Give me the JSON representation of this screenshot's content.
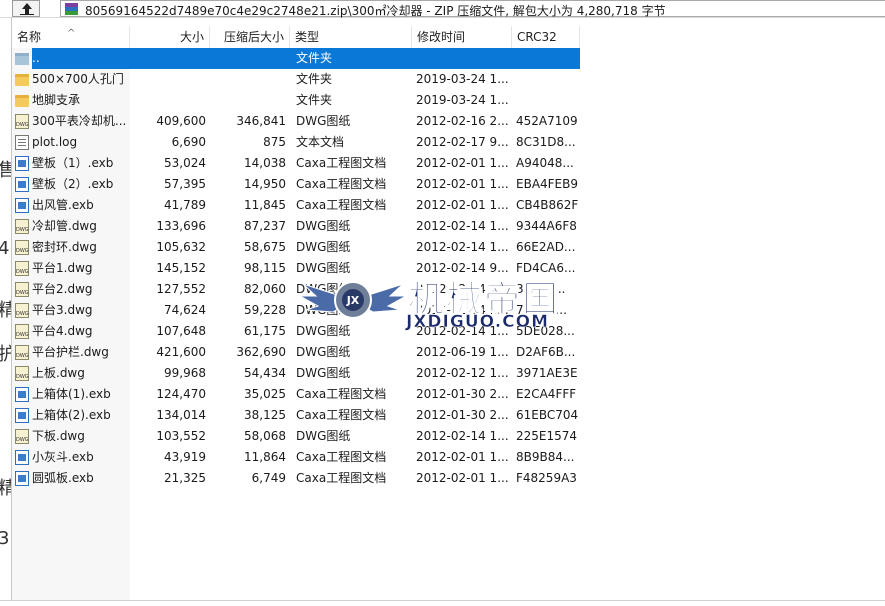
{
  "pathbar": {
    "path_text": "80569164522d7489e70c4e29c2748e21.zip\\300㎡冷却器 - ZIP 压缩文件, 解包大小为 4,280,718 字节"
  },
  "columns": {
    "name": "名称",
    "size": "大小",
    "packed": "压缩后大小",
    "type": "类型",
    "modified": "修改时间",
    "crc": "CRC32"
  },
  "rows": [
    {
      "name": "..",
      "icon": "folder-up",
      "size": "",
      "packed": "",
      "type": "文件夹",
      "modified": "",
      "crc": ""
    },
    {
      "name": "500×700人孔门",
      "icon": "folder",
      "size": "",
      "packed": "",
      "type": "文件夹",
      "modified": "2019-03-24 1...",
      "crc": ""
    },
    {
      "name": "地脚支承",
      "icon": "folder",
      "size": "",
      "packed": "",
      "type": "文件夹",
      "modified": "2019-03-24 1...",
      "crc": ""
    },
    {
      "name": "300平表冷却机...",
      "icon": "dwg",
      "size": "409,600",
      "packed": "346,841",
      "type": "DWG图纸",
      "modified": "2012-02-16 2...",
      "crc": "452A7109"
    },
    {
      "name": "plot.log",
      "icon": "txt",
      "size": "6,690",
      "packed": "875",
      "type": "文本文档",
      "modified": "2012-02-17 9...",
      "crc": "8C31D8..."
    },
    {
      "name": "壁板（1）.exb",
      "icon": "exb",
      "size": "53,024",
      "packed": "14,038",
      "type": "Caxa工程图文档",
      "modified": "2012-02-01 1...",
      "crc": "A94048..."
    },
    {
      "name": "壁板（2）.exb",
      "icon": "exb",
      "size": "57,395",
      "packed": "14,950",
      "type": "Caxa工程图文档",
      "modified": "2012-02-01 1...",
      "crc": "EBA4FEB9"
    },
    {
      "name": "出风管.exb",
      "icon": "exb",
      "size": "41,789",
      "packed": "11,845",
      "type": "Caxa工程图文档",
      "modified": "2012-02-01 1...",
      "crc": "CB4B862F"
    },
    {
      "name": "冷却管.dwg",
      "icon": "dwg",
      "size": "133,696",
      "packed": "87,237",
      "type": "DWG图纸",
      "modified": "2012-02-14 1...",
      "crc": "9344A6F8"
    },
    {
      "name": "密封环.dwg",
      "icon": "dwg",
      "size": "105,632",
      "packed": "58,675",
      "type": "DWG图纸",
      "modified": "2012-02-14 1...",
      "crc": "66E2AD..."
    },
    {
      "name": "平台1.dwg",
      "icon": "dwg",
      "size": "145,152",
      "packed": "98,115",
      "type": "DWG图纸",
      "modified": "2012-02-14 9...",
      "crc": "FD4CA6..."
    },
    {
      "name": "平台2.dwg",
      "icon": "dwg",
      "size": "127,552",
      "packed": "82,060",
      "type": "DWG图纸",
      "modified": "2012-02-14 1...",
      "crc": "3F8B2..."
    },
    {
      "name": "平台3.dwg",
      "icon": "dwg",
      "size": "74,624",
      "packed": "59,228",
      "type": "DWG图纸",
      "modified": "2012-02-14 1...",
      "crc": "7A1C0..."
    },
    {
      "name": "平台4.dwg",
      "icon": "dwg",
      "size": "107,648",
      "packed": "61,175",
      "type": "DWG图纸",
      "modified": "2012-02-14 1...",
      "crc": "5DE028..."
    },
    {
      "name": "平台护栏.dwg",
      "icon": "dwg",
      "size": "421,600",
      "packed": "362,690",
      "type": "DWG图纸",
      "modified": "2012-06-19 1...",
      "crc": "D2AF6B..."
    },
    {
      "name": "上板.dwg",
      "icon": "dwg",
      "size": "99,968",
      "packed": "54,434",
      "type": "DWG图纸",
      "modified": "2012-02-12 1...",
      "crc": "3971AE3E"
    },
    {
      "name": "上箱体(1).exb",
      "icon": "exb",
      "size": "124,470",
      "packed": "35,025",
      "type": "Caxa工程图文档",
      "modified": "2012-01-30 2...",
      "crc": "E2CA4FFF"
    },
    {
      "name": "上箱体(2).exb",
      "icon": "exb",
      "size": "134,014",
      "packed": "38,125",
      "type": "Caxa工程图文档",
      "modified": "2012-01-30 2...",
      "crc": "61EBC704"
    },
    {
      "name": "下板.dwg",
      "icon": "dwg",
      "size": "103,552",
      "packed": "58,068",
      "type": "DWG图纸",
      "modified": "2012-02-14 1...",
      "crc": "225E1574"
    },
    {
      "name": "小灰斗.exb",
      "icon": "exb",
      "size": "43,919",
      "packed": "11,864",
      "type": "Caxa工程图文档",
      "modified": "2012-02-01 1...",
      "crc": "8B9B84..."
    },
    {
      "name": "圆弧板.exb",
      "icon": "exb",
      "size": "21,325",
      "packed": "6,749",
      "type": "Caxa工程图文档",
      "modified": "2012-02-01 1...",
      "crc": "F48259A3"
    }
  ],
  "watermark": {
    "title": "机械帝国",
    "url": "JXDIGUO.COM",
    "logo_text": "JX"
  },
  "left_edge_glyphs": [
    "售",
    "4",
    "精",
    "护",
    "精",
    "3"
  ],
  "colors": {
    "selection": "#0a78d7",
    "watermark": "#1b2a6b"
  }
}
